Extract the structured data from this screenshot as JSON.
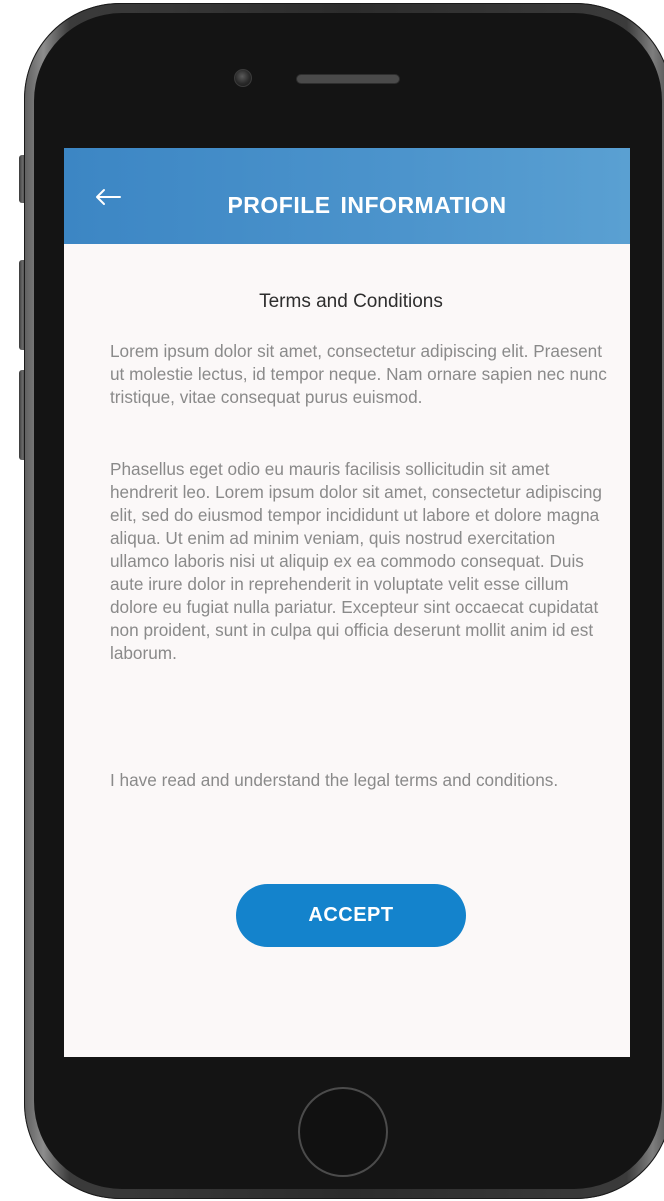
{
  "header": {
    "title": "PROFILE INFORMATION",
    "back_icon": "arrow-left-icon",
    "background_color": "#4691c9"
  },
  "terms": {
    "title": "Terms and Conditions",
    "paragraphs": [
      "Lorem ipsum dolor sit amet, consectetur adipiscing elit. Praesent ut molestie lectus, id tempor neque. Nam ornare sapien nec nunc tristique, vitae consequat purus euismod.",
      "Phasellus eget odio eu mauris facilisis sollicitudin sit amet hendrerit leo. Lorem ipsum dolor sit amet, consectetur adipiscing elit, sed do eiusmod tempor incididunt ut labore et dolore magna aliqua. Ut enim ad minim veniam, quis nostrud exercitation ullamco laboris nisi ut aliquip ex ea commodo consequat. Duis aute irure dolor in reprehenderit in voluptate velit esse cillum dolore eu fugiat nulla pariatur. Excepteur sint occaecat cupidatat non proident, sunt in culpa qui officia deserunt mollit anim id est laborum.",
      "I have read and understand the legal terms and conditions."
    ]
  },
  "actions": {
    "accept_label": "ACCEPT",
    "accept_color": "#1483cc"
  },
  "colors": {
    "screen_background": "#fbf8f8",
    "body_text": "#8a8a8a",
    "title_text": "#2e2e2e"
  }
}
